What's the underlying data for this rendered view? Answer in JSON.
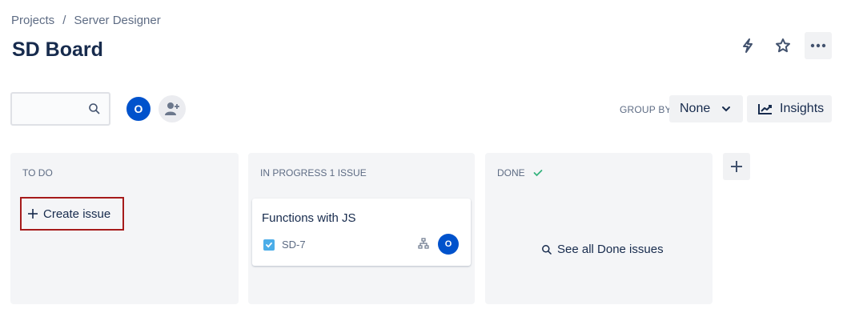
{
  "breadcrumb": {
    "items": [
      "Projects",
      "/",
      "Server Designer"
    ]
  },
  "page": {
    "title": "SD Board"
  },
  "toolbar": {
    "search_placeholder": "",
    "user_avatar": "O",
    "group_by_label": "GROUP BY",
    "group_by_value": "None",
    "insights_label": "Insights"
  },
  "icons": {
    "automation": "lightning-icon",
    "star": "star-icon",
    "more": "more-icon",
    "search": "search-icon",
    "add_people": "add-people-icon",
    "insights": "trend-icon"
  },
  "columns": [
    {
      "title": "TO DO",
      "create_label": "Create issue"
    },
    {
      "title": "IN PROGRESS 1 ISSUE",
      "card": {
        "title": "Functions with JS",
        "key": "SD-7",
        "assignee": "O"
      }
    },
    {
      "title": "DONE",
      "see_all_label": "See all Done issues"
    }
  ],
  "colors": {
    "accent": "#0052cc",
    "done_check": "#36b37e",
    "highlight_border": "#a61b1b"
  }
}
